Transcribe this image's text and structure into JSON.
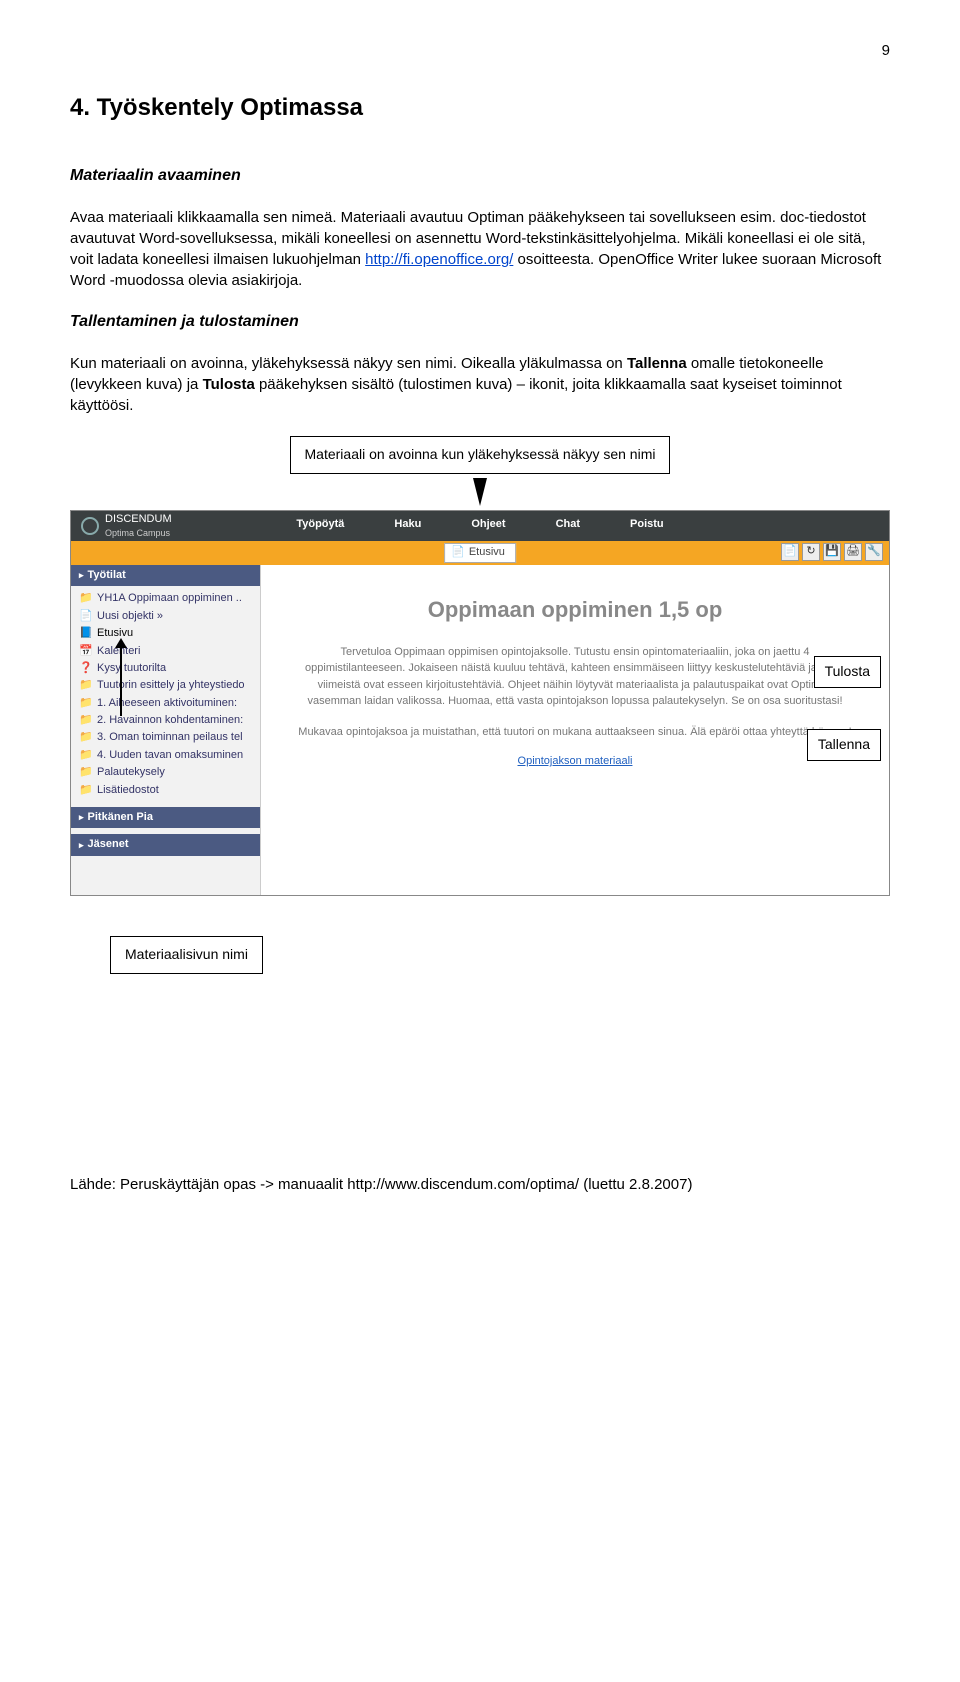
{
  "page_number": "9",
  "heading": "4. Työskentely Optimassa",
  "section1_title": "Materiaalin avaaminen",
  "para1_a": "Avaa materiaali klikkaamalla sen nimeä. Materiaali avautuu Optiman pääkehykseen tai sovellukseen esim. doc-tiedostot avautuvat Word-sovelluksessa, mikäli koneellesi on asennettu Word-tekstinkäsittelyohjelma. Mikäli koneellasi ei ole sitä, voit ladata koneellesi ilmaisen lukuohjelman ",
  "para1_link": "http://fi.openoffice.org/",
  "para1_b": " osoitteesta. OpenOffice Writer lukee suoraan Microsoft Word -muodossa olevia asiakirjoja.",
  "section2_title": "Tallentaminen ja tulostaminen",
  "para2_a": "Kun materiaali on avoinna, yläkehyksessä näkyy sen nimi. Oikealla yläkulmassa on ",
  "para2_b": " omalle tietokoneelle (levykkeen kuva) ja ",
  "para2_c": " pääkehyksen sisältö (tulostimen kuva) – ikonit, joita klikkaamalla saat kyseiset toiminnot käyttöösi.",
  "strong_tallenna": "Tallenna",
  "strong_tulosta": "Tulosta",
  "callout_top": "Materiaali on avoinna kun yläkehyksessä näkyy sen nimi",
  "callout_right1": "Tulosta",
  "callout_right2": "Tallenna",
  "callout_bottom": "Materiaalisivun nimi",
  "shot": {
    "brand1": "DISCENDUM",
    "brand2": "Optima Campus",
    "topnav": [
      "Työpöytä",
      "Haku",
      "Ohjeet",
      "Chat",
      "Poistu"
    ],
    "home_tab": "Etusivu",
    "sidebar": {
      "hdr1": "Työtilat",
      "hdr2": "Pitkänen Pia",
      "hdr3": "Jäsenet",
      "items": [
        {
          "icon": "📁",
          "label": "YH1A Oppimaan oppiminen .."
        },
        {
          "icon": "📄",
          "label": "Uusi objekti  »"
        },
        {
          "icon": "📘",
          "label": "Etusivu"
        },
        {
          "icon": "📅",
          "label": "Kalenteri"
        },
        {
          "icon": "❓",
          "label": "Kysy tuutorilta"
        },
        {
          "icon": "📁",
          "label": "Tuutorin esittely ja yhteystiedo"
        },
        {
          "icon": "📁",
          "label": "1. Aiheeseen aktivoituminen:"
        },
        {
          "icon": "📁",
          "label": "2. Havainnon kohdentaminen:"
        },
        {
          "icon": "📁",
          "label": "3. Oman toiminnan peilaus tel"
        },
        {
          "icon": "📁",
          "label": "4. Uuden tavan omaksuminen"
        },
        {
          "icon": "📁",
          "label": "Palautekysely"
        },
        {
          "icon": "📁",
          "label": "Lisätiedostot"
        }
      ]
    },
    "content": {
      "title": "Oppimaan oppiminen 1,5 op",
      "p1": "Tervetuloa Oppimaan oppimisen opintojaksolle. Tutustu ensin opintomateriaaliin, joka on jaettu 4 oppimistilanteeseen. Jokaiseen näistä kuuluu tehtävä, kahteen ensimmäiseen liittyy keskustelutehtäviä ja kaksi viimeistä ovat esseen kirjoitustehtäviä. Ohjeet näihin löytyvät materiaalista ja palautuspaikat ovat Optiman vasemman laidan valikossa. Huomaa, että vasta opintojakson lopussa palautekyselyn. Se on osa suoritustasi!",
      "p2": "Mukavaa opintojaksoa ja muistathan, että tuutori on mukana auttaakseen sinua. Älä epäröi ottaa yhteyttä häneen!",
      "link": "Opintojakson materiaali"
    },
    "toolbar_icons": [
      "file-icon",
      "refresh-icon",
      "save-icon",
      "print-icon",
      "settings-icon"
    ]
  },
  "footer_a": "Lähde: Peruskäyttäjän opas -> manuaalit ",
  "footer_link": "http://www.discendum.com/optima/",
  "footer_b": "  (luettu 2.8.2007)"
}
